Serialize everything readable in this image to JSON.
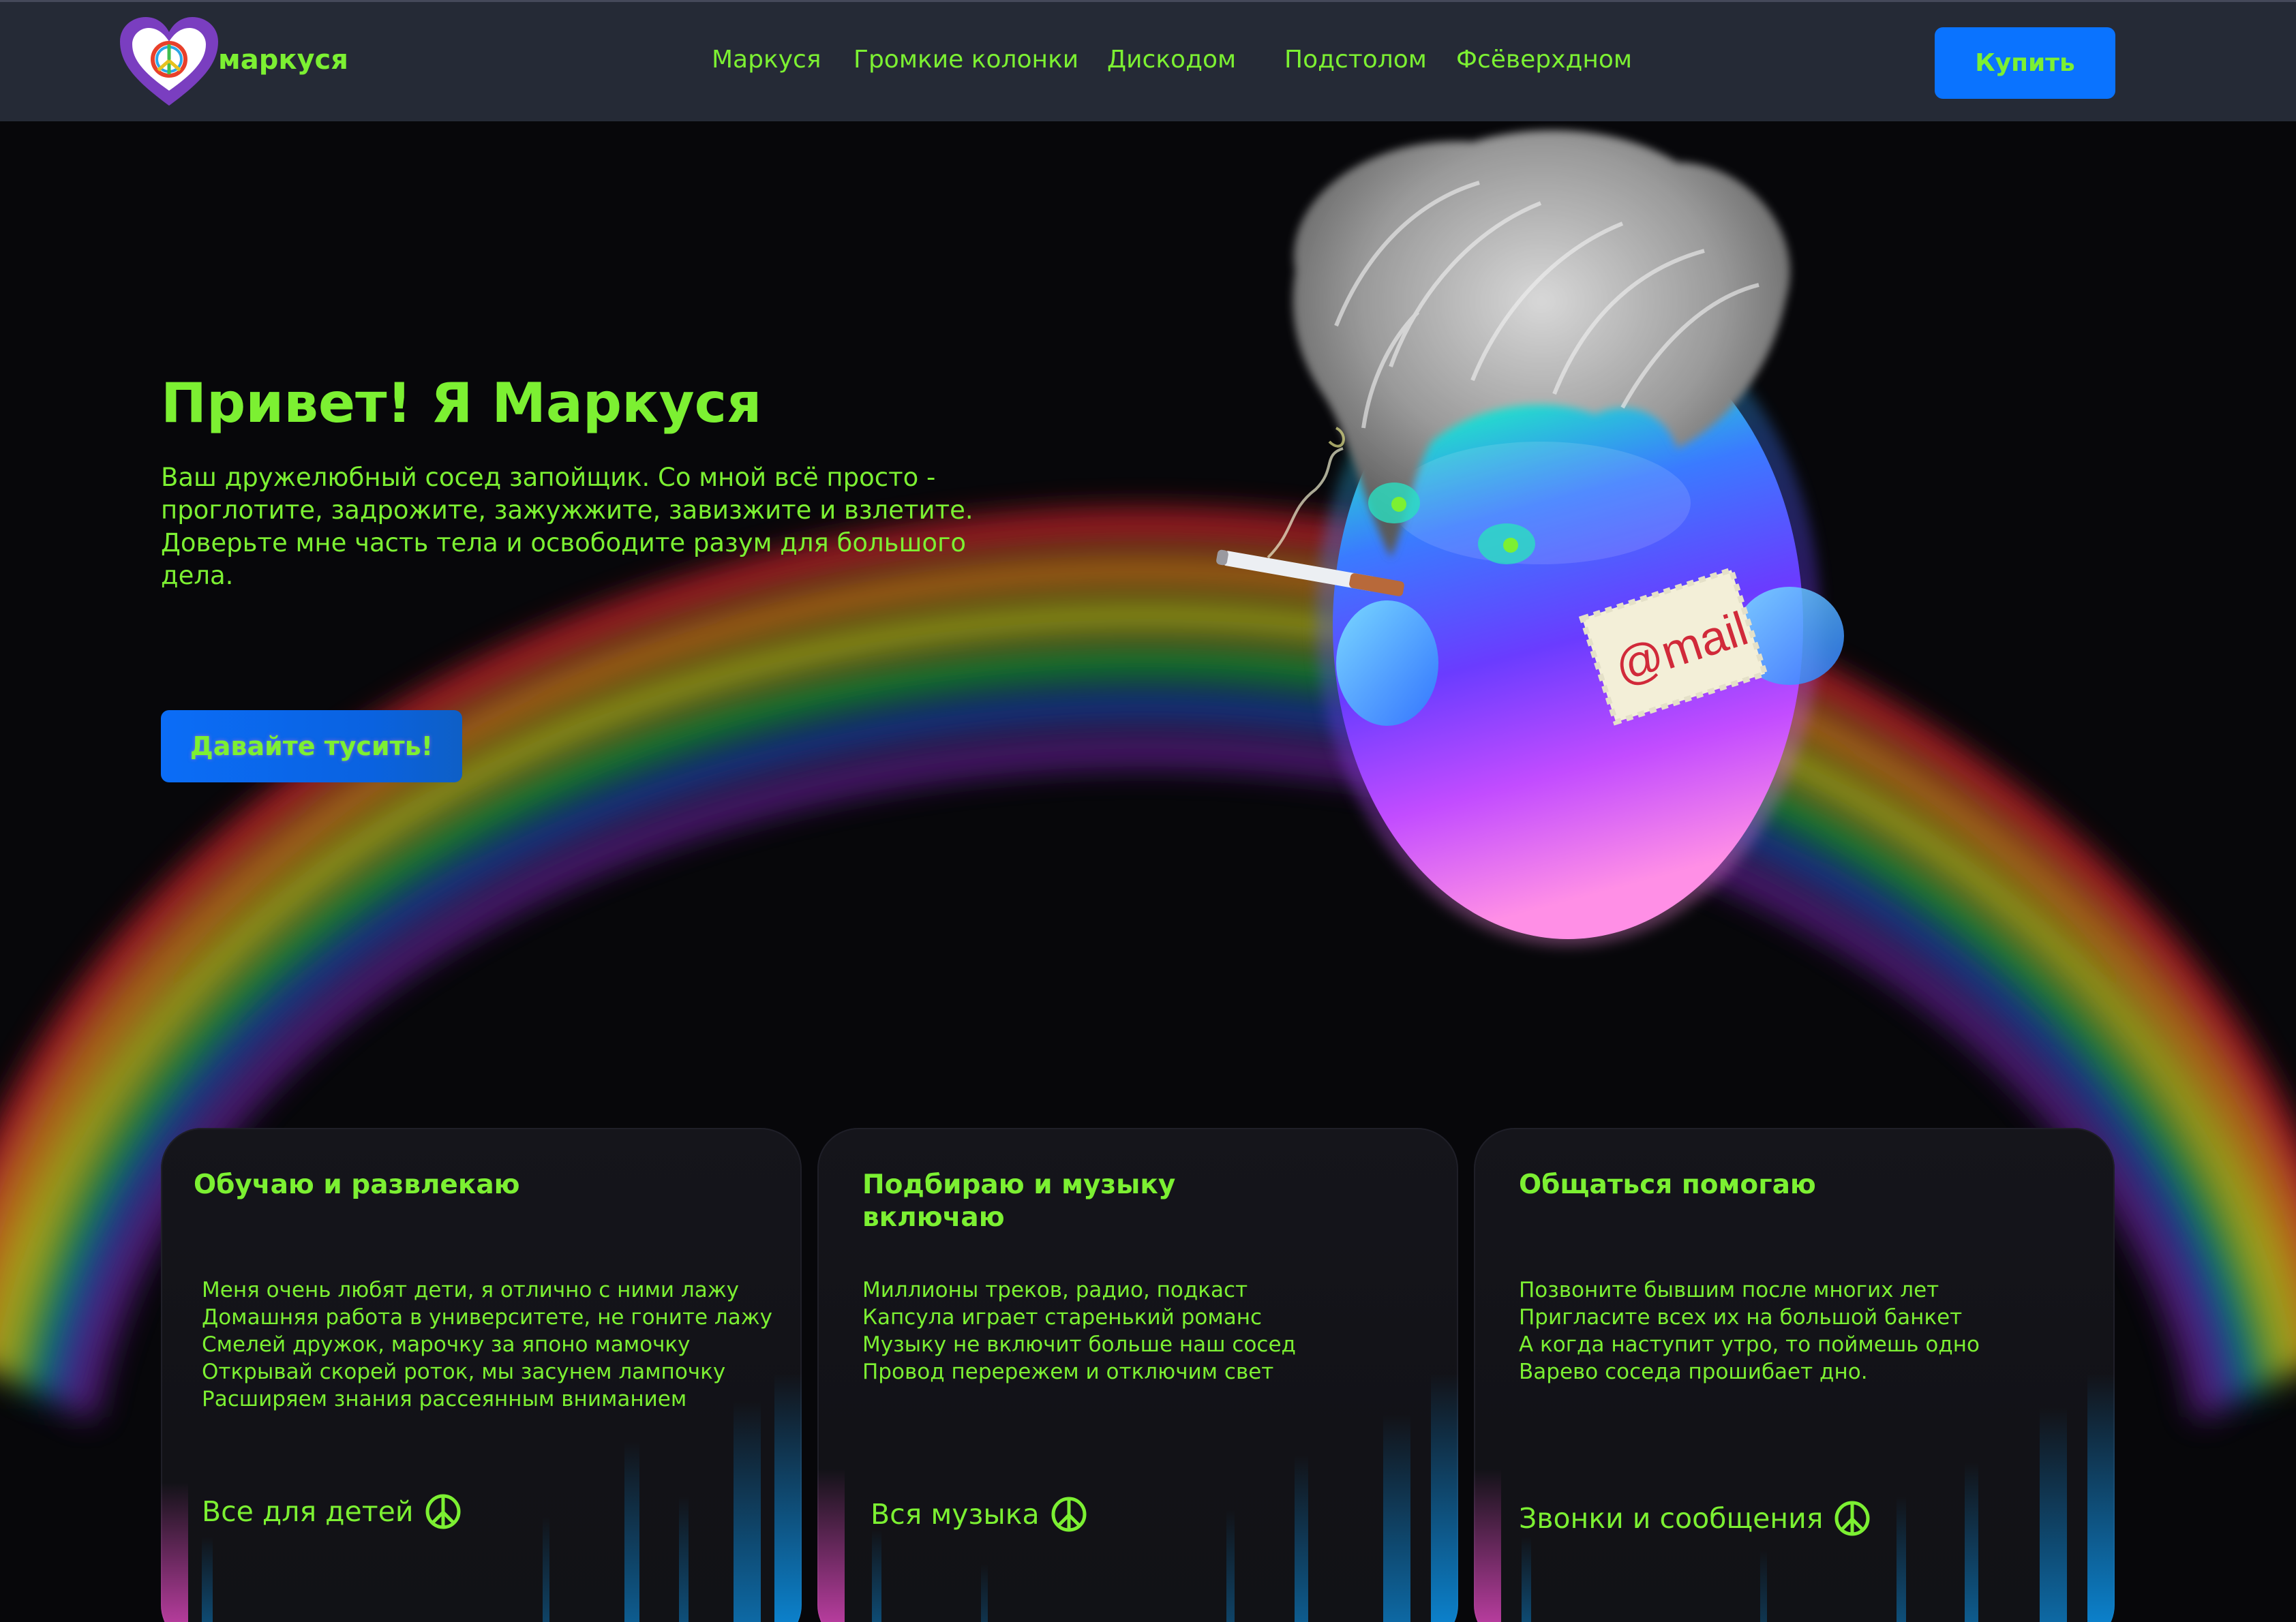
{
  "header": {
    "brand": "маркуся",
    "nav": [
      "Маркуся",
      "Громкие колонки",
      "Дискодом",
      "Подстолом",
      "Фсёверхдном"
    ],
    "buy_label": "Купить"
  },
  "hero": {
    "title": "Привет! Я Маркуся",
    "text": "Ваш дружелюбный сосед запойщик. Со мной всё просто - проглотите, задрожите, зажужжите, завизжите и взлетите. Доверьте мне часть тела и освободите разум для большого дела.",
    "button": "Давайте тусить!",
    "mail_stamp": "@mail"
  },
  "cards": [
    {
      "title": "Обучаю и развлекаю",
      "lines": [
        "Меня очень любят дети,  я отлично с ними лажу",
        "Домашняя работа в университете, не гоните лажу",
        "Смелей дружок, марочку за японо мамочку",
        "Открывай скорей роток,  мы засунем лампочку",
        "Расширяем знания рассеянным вниманием"
      ],
      "link": "Все для детей"
    },
    {
      "title": "Подбираю и музыку включаю",
      "lines": [
        "Миллионы треков, радио, подкаст",
        "Капсула  играет старенький романс",
        "Музыку не включит больше наш сосед",
        "Провод перережем и отключим свет"
      ],
      "link": "Вся музыка"
    },
    {
      "title": "Общаться помогаю",
      "lines": [
        "Позвоните бывшим после многих лет",
        "Пригласите всех их на большой банкет",
        "А когда наступит утро, то поймешь одно",
        "Варево соседа прошибает дно."
      ],
      "link": "Звонки и сообщения"
    }
  ],
  "colors": {
    "accent_text": "#7cf032",
    "primary_button": "#0a73ff",
    "header_bg": "#252a36",
    "page_bg": "#07070a"
  }
}
